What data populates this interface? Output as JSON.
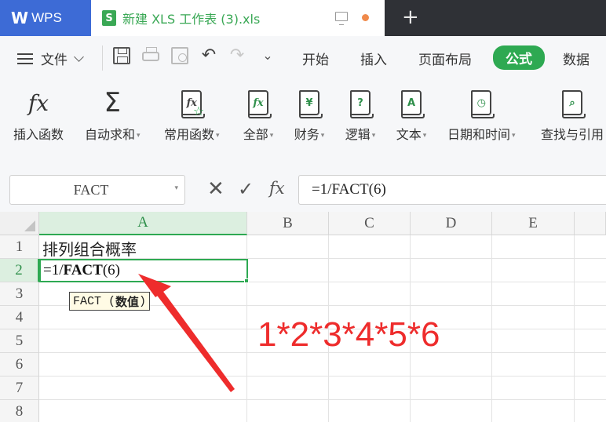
{
  "titlebar": {
    "app_tab": "WPS",
    "doc_tab": "新建 XLS 工作表 (3).xls",
    "xls_badge": "S",
    "new_tab": "+"
  },
  "menubar": {
    "file_label": "文件",
    "tabs": [
      "开始",
      "插入",
      "页面布局",
      "公式",
      "数据"
    ],
    "active_tab": "公式"
  },
  "ribbon": {
    "buttons": [
      {
        "label": "插入函数",
        "icon": "insert-function-icon",
        "glyph": "fx",
        "dropdown": false
      },
      {
        "label": "自动求和",
        "icon": "autosum-icon",
        "glyph": "Σ",
        "dropdown": true
      },
      {
        "label": "常用函数",
        "icon": "common-functions-icon",
        "glyph": "fx",
        "dropdown": true
      },
      {
        "label": "全部",
        "icon": "all-functions-icon",
        "glyph": "fx",
        "dropdown": true
      },
      {
        "label": "财务",
        "icon": "finance-icon",
        "glyph": "¥",
        "dropdown": true
      },
      {
        "label": "逻辑",
        "icon": "logic-icon",
        "glyph": "?",
        "dropdown": true
      },
      {
        "label": "文本",
        "icon": "text-icon",
        "glyph": "A",
        "dropdown": true
      },
      {
        "label": "日期和时间",
        "icon": "datetime-icon",
        "glyph": "◷",
        "dropdown": true
      },
      {
        "label": "查找与引用",
        "icon": "lookup-icon",
        "glyph": "⌕",
        "dropdown": false
      }
    ]
  },
  "formula_bar": {
    "name_box": "FACT",
    "fx_label": "fx",
    "formula": "=1/FACT(6)"
  },
  "grid": {
    "columns": [
      "A",
      "B",
      "C",
      "D",
      "E"
    ],
    "selected_column": "A",
    "rows": [
      "1",
      "2",
      "3",
      "4",
      "5",
      "6",
      "7",
      "8"
    ],
    "selected_row": "2",
    "a1": "排列组合概率",
    "a2_prefix": "=1/",
    "a2_function": "FACT",
    "a2_args": "(6)",
    "tooltip_name": "FACT (",
    "tooltip_arg": "数值",
    "tooltip_close": ")"
  },
  "annotation": {
    "text": "1*2*3*4*5*6",
    "color": "#ee2c2c"
  },
  "colors": {
    "accent": "#2ea952",
    "wps_blue": "#3d6bd6"
  }
}
